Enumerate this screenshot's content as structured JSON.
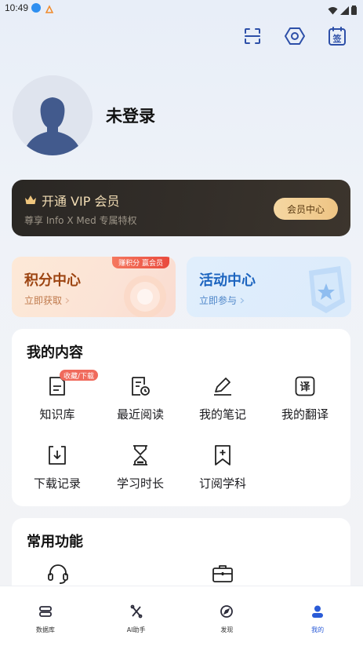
{
  "status_bar": {
    "time": "10:49"
  },
  "header": {
    "icons": [
      "scan-icon",
      "settings-icon",
      "sign-in-icon"
    ],
    "sign_in_char": "签"
  },
  "profile": {
    "login_status": "未登录"
  },
  "vip": {
    "title": "开通 VIP 会员",
    "subtitle": "尊享 Info X Med 专属特权",
    "button": "会员中心",
    "accent": "#f2ddb5"
  },
  "points": {
    "title": "积分中心",
    "subtitle": "立即获取",
    "badge": "赚积分 赢会员"
  },
  "activity": {
    "title": "活动中心",
    "subtitle": "立即参与"
  },
  "my_content": {
    "title": "我的内容",
    "items": [
      {
        "label": "知识库",
        "icon": "document-icon",
        "badge": "收藏/下载"
      },
      {
        "label": "最近阅读",
        "icon": "recent-reading-icon"
      },
      {
        "label": "我的笔记",
        "icon": "pencil-icon"
      },
      {
        "label": "我的翻译",
        "icon": "translate-icon",
        "char": "译"
      },
      {
        "label": "下载记录",
        "icon": "download-icon"
      },
      {
        "label": "学习时长",
        "icon": "hourglass-icon"
      },
      {
        "label": "订阅学科",
        "icon": "bookmark-add-icon"
      }
    ]
  },
  "common": {
    "title": "常用功能",
    "icons": [
      "headset-icon",
      "toolbox-icon"
    ]
  },
  "tabbar": {
    "tabs": [
      {
        "label": "数据库",
        "icon": "database-icon"
      },
      {
        "label": "AI助手",
        "icon": "ai-assistant-icon"
      },
      {
        "label": "发现",
        "icon": "compass-icon"
      },
      {
        "label": "我的",
        "icon": "person-icon",
        "active": true
      }
    ],
    "active_color": "#2a5bd7"
  }
}
